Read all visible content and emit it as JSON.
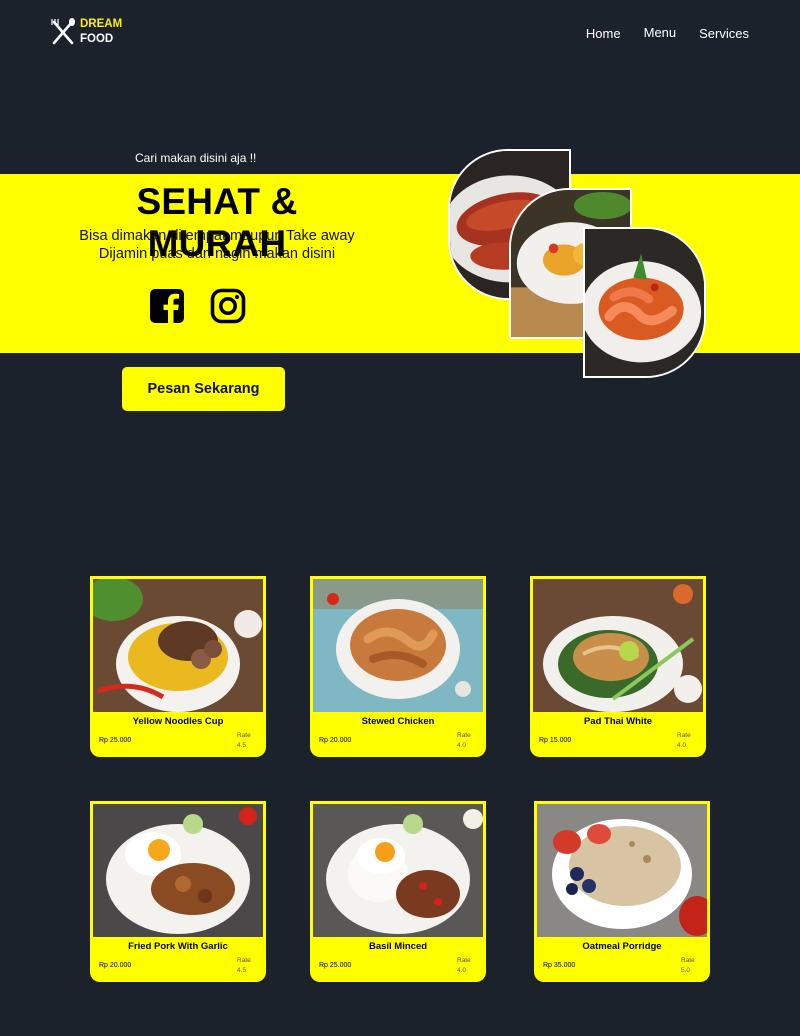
{
  "brand": {
    "line1": "DREAM",
    "line2": "FOOD",
    "accent": "#fcee0a"
  },
  "nav": {
    "home": "Home",
    "menu": "Menu",
    "services": "Services"
  },
  "hero": {
    "tagline": "Cari makan disini aja !!",
    "title": "SEHAT & MURAH",
    "subtitle_line1": "Bisa dimakan ditempat maupun Take away",
    "subtitle_line2": "Dijamin puas dan nagih makan disini",
    "cta": "Pesan Sekarang",
    "social": [
      "facebook-icon",
      "instagram-icon"
    ]
  },
  "colors": {
    "background": "#1b222b",
    "yellow": "#ffff00"
  },
  "menu": [
    {
      "name": "Yellow Noodles Cup",
      "price": "Rp 25.000",
      "rate_label": "Rate",
      "rate": "4.5"
    },
    {
      "name": "Stewed Chicken",
      "price": "Rp 20.000",
      "rate_label": "Rate",
      "rate": "4.0"
    },
    {
      "name": "Pad Thai White",
      "price": "Rp 15.000",
      "rate_label": "Rate",
      "rate": "4.0"
    },
    {
      "name": "Fried Pork With Garlic",
      "price": "Rp 20.000",
      "rate_label": "Rate",
      "rate": "4.5"
    },
    {
      "name": "Basil Minced",
      "price": "Rp 25.000",
      "rate_label": "Rate",
      "rate": "4.0"
    },
    {
      "name": "Oatmeal Porridge",
      "price": "Rp 35.000",
      "rate_label": "Rate",
      "rate": "5.0"
    }
  ]
}
